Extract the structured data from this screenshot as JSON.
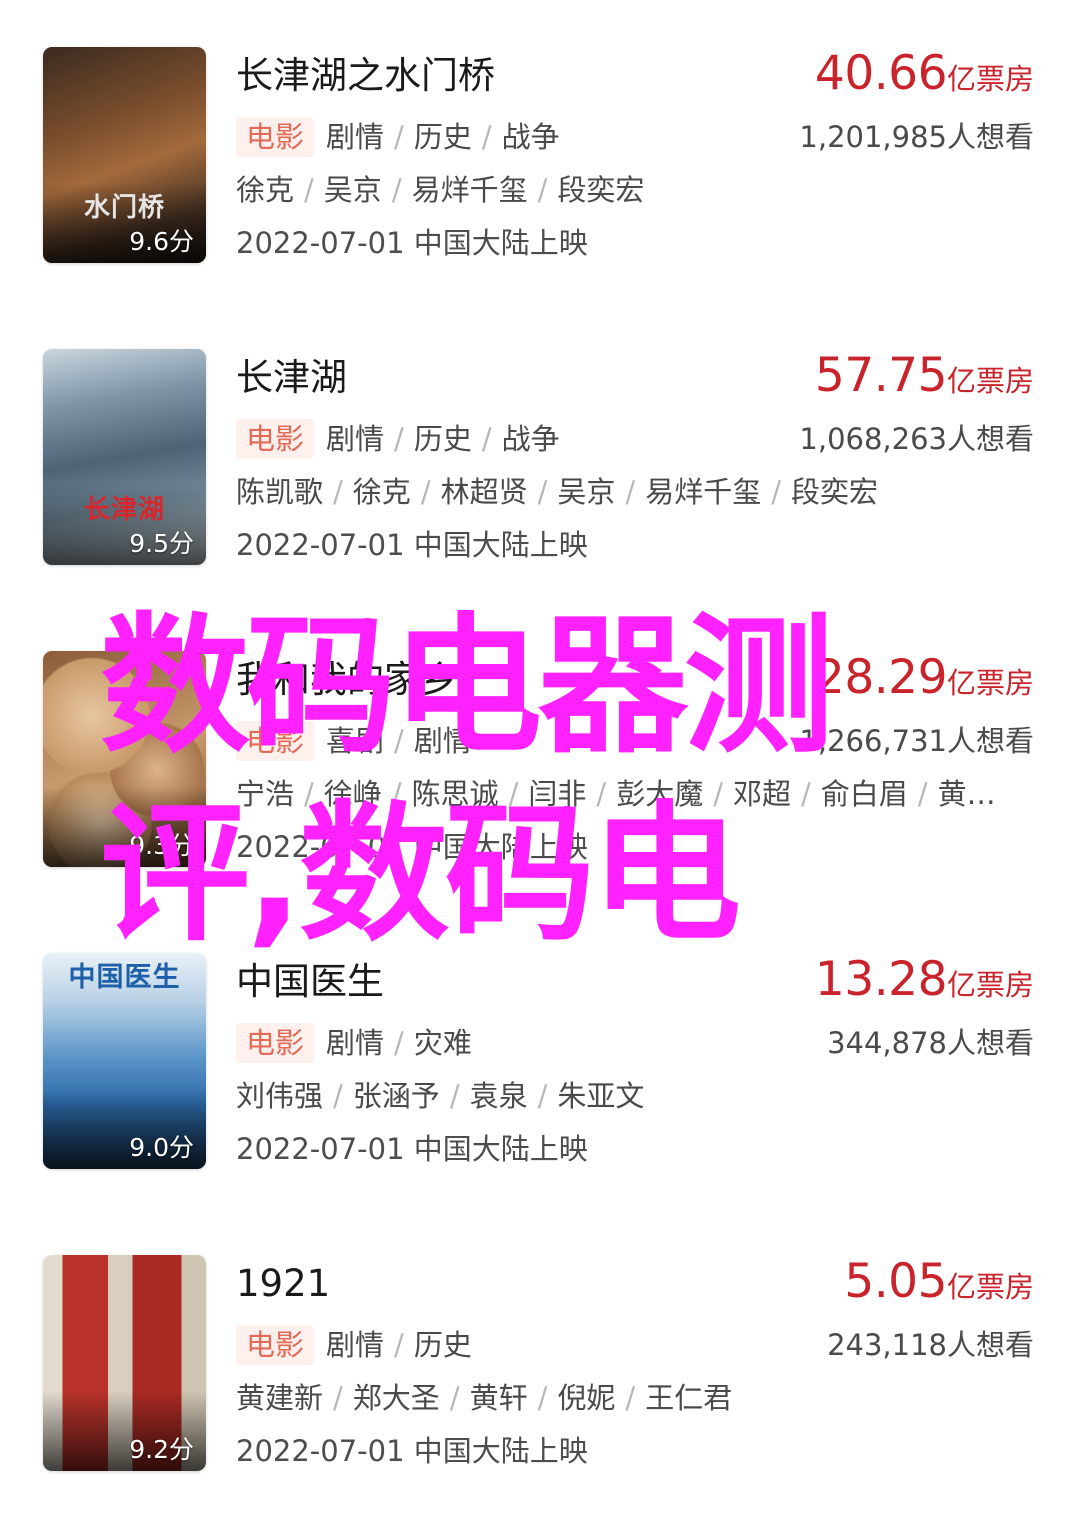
{
  "movies": [
    {
      "title": "长津湖之水门桥",
      "poster_text": "水门桥",
      "score": "9.6分",
      "box_value": "40.66",
      "box_unit": "亿票房",
      "tag": "电影",
      "genres": [
        "剧情",
        "历史",
        "战争"
      ],
      "want": "1,201,985人想看",
      "cast": [
        "徐克",
        "吴京",
        "易烊千玺",
        "段奕宏"
      ],
      "release": "2022-07-01 中国大陆上映",
      "poster_colors": [
        "#5a3a22",
        "#8a5a36",
        "#2b1d15"
      ],
      "poster_title_color": "#e5e5e5"
    },
    {
      "title": "长津湖",
      "poster_text": "长津湖",
      "score": "9.5分",
      "box_value": "57.75",
      "box_unit": "亿票房",
      "tag": "电影",
      "genres": [
        "剧情",
        "历史",
        "战争"
      ],
      "want": "1,068,263人想看",
      "cast": [
        "陈凯歌",
        "徐克",
        "林超贤",
        "吴京",
        "易烊千玺",
        "段奕宏"
      ],
      "release": "2022-07-01 中国大陆上映",
      "poster_colors": [
        "#8fa7b8",
        "#4e6577",
        "#d9e3ea"
      ],
      "poster_title_color": "#d8262e"
    },
    {
      "title": "我和我的家乡",
      "poster_text": "",
      "score": "9.3分",
      "box_value": "28.29",
      "box_unit": "亿票房",
      "tag": "电影",
      "genres": [
        "喜剧",
        "剧情"
      ],
      "want": "1,266,731人想看",
      "cast": [
        "宁浩",
        "徐峥",
        "陈思诚",
        "闫非",
        "彭大魔",
        "邓超",
        "俞白眉",
        "黄…"
      ],
      "release": "2022-07-01 中国大陆上映",
      "poster_colors": [
        "#c99a6b",
        "#e8c7a0",
        "#7a5234"
      ],
      "poster_title_color": "#ffffff"
    },
    {
      "title": "中国医生",
      "poster_text": "中国医生",
      "score": "9.0分",
      "box_value": "13.28",
      "box_unit": "亿票房",
      "tag": "电影",
      "genres": [
        "剧情",
        "灾难"
      ],
      "want": "344,878人想看",
      "cast": [
        "刘伟强",
        "张涵予",
        "袁泉",
        "朱亚文"
      ],
      "release": "2022-07-01 中国大陆上映",
      "poster_colors": [
        "#2c6aa8",
        "#5b95c9",
        "#1d3f66"
      ],
      "poster_title_color": "#ffffff"
    },
    {
      "title": "1921",
      "poster_text": "1921",
      "score": "9.2分",
      "box_value": "5.05",
      "box_unit": "亿票房",
      "tag": "电影",
      "genres": [
        "剧情",
        "历史"
      ],
      "want": "243,118人想看",
      "cast": [
        "黄建新",
        "郑大圣",
        "黄轩",
        "倪妮",
        "王仁君"
      ],
      "release": "2022-07-01 中国大陆上映",
      "poster_colors": [
        "#b8322a",
        "#d8cfc0",
        "#3a3a3a"
      ],
      "poster_title_color": "#c41e24"
    }
  ],
  "overlay": {
    "line1": "数码电器测",
    "line2": "评,数码电",
    "color": "#ff22ff"
  }
}
